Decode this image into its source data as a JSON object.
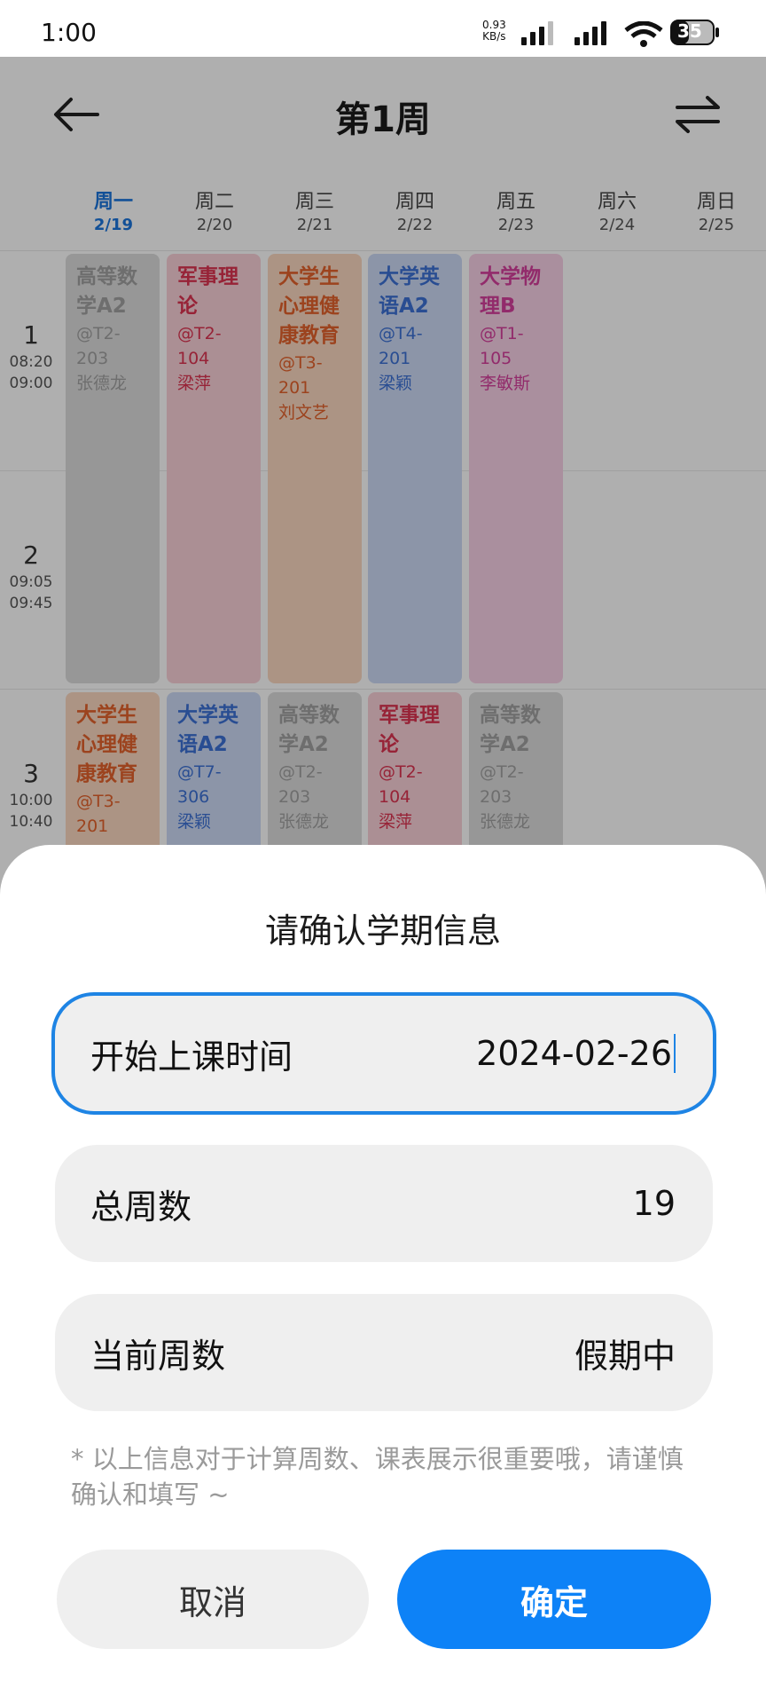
{
  "status_bar": {
    "time": "1:00",
    "speed_value": "0.93",
    "speed_unit": "KB/s",
    "battery": "35"
  },
  "header": {
    "title": "第1周",
    "back_icon": "arrow-left-icon",
    "swap_icon": "swap-arrows-icon"
  },
  "days": [
    {
      "name": "周一",
      "date": "2/19",
      "active": true
    },
    {
      "name": "周二",
      "date": "2/20"
    },
    {
      "name": "周三",
      "date": "2/21"
    },
    {
      "name": "周四",
      "date": "2/22"
    },
    {
      "name": "周五",
      "date": "2/23"
    },
    {
      "name": "周六",
      "date": "2/24"
    },
    {
      "name": "周日",
      "date": "2/25"
    }
  ],
  "periods": [
    {
      "num": "1",
      "start": "08:20",
      "end": "09:00"
    },
    {
      "num": "2",
      "start": "09:05",
      "end": "09:45"
    },
    {
      "num": "3",
      "start": "10:00",
      "end": "10:40"
    }
  ],
  "courses": [
    {
      "name": "高等数学A2",
      "room": "@T2-203",
      "teacher": "张德龙",
      "color": "#9e9e9e",
      "bg": "#d9d9d9"
    },
    {
      "name": "军事理论",
      "room": "@T2-104",
      "teacher": "梁萍",
      "color": "#d8334f",
      "bg": "#f5cdd4"
    },
    {
      "name": "大学生心理健康教育",
      "room": "@T3-201",
      "teacher": "刘文艺",
      "color": "#e0612c",
      "bg": "#f6d4bd"
    },
    {
      "name": "大学英语A2",
      "room": "@T4-201",
      "teacher": "梁颖",
      "color": "#3b6fd1",
      "bg": "#c9d6f1"
    },
    {
      "name": "大学物理B",
      "room": "@T1-105",
      "teacher": "李敏斯",
      "color": "#d23e9a",
      "bg": "#f4cde3"
    },
    {
      "name": "大学生心理健康教育",
      "room": "@T3-201",
      "teacher": "",
      "color": "#e0612c",
      "bg": "#f6d4bd"
    },
    {
      "name": "大学英语A2",
      "room": "@T7-306",
      "teacher": "梁颖",
      "color": "#3b6fd1",
      "bg": "#c9d6f1"
    },
    {
      "name": "高等数学A2",
      "room": "@T2-203",
      "teacher": "张德龙",
      "color": "#9e9e9e",
      "bg": "#d9d9d9"
    },
    {
      "name": "军事理论",
      "room": "@T2-104",
      "teacher": "梁萍",
      "color": "#d8334f",
      "bg": "#f5cdd4"
    },
    {
      "name": "高等数学A2",
      "room": "@T2-203",
      "teacher": "张德龙",
      "color": "#9e9e9e",
      "bg": "#d9d9d9"
    }
  ],
  "dialog": {
    "title": "请确认学期信息",
    "start_label": "开始上课时间",
    "start_value": "2024-02-26",
    "total_label": "总周数",
    "total_value": "19",
    "current_label": "当前周数",
    "current_value": "假期中",
    "note": "* 以上信息对于计算周数、课表展示很重要哦，请谨慎确认和填写 ~",
    "cancel": "取消",
    "confirm": "确定"
  },
  "colors": {
    "accent": "#0d82f7",
    "focus_border": "#1e84e4"
  }
}
